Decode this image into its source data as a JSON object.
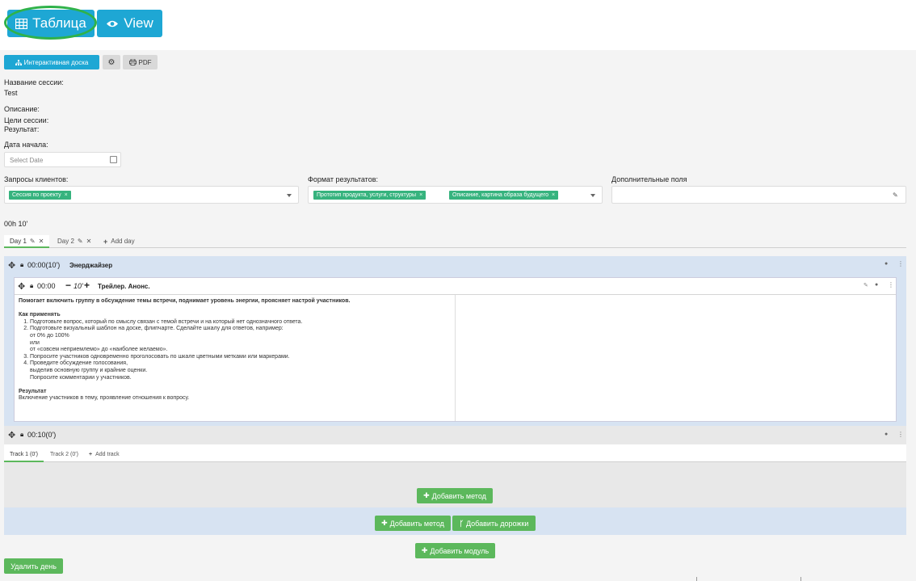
{
  "top_buttons": {
    "table": "Таблица",
    "view": "View"
  },
  "toolbar": {
    "board": "Интерактивная доска",
    "pdf": "PDF"
  },
  "session": {
    "name_label": "Название сессии:",
    "name_value": "Test",
    "description_label": "Описание:",
    "goals_label": "Цели сессии:",
    "result_label": "Результат:",
    "start_label": "Дата начала:",
    "date_placeholder": "Select Date"
  },
  "filters": {
    "client_requests_label": "Запросы клиентов:",
    "client_tag": "Сессия по проекту",
    "result_format_label": "Формат результатов:",
    "format_tags": [
      "Прототип продукта, услуги, структуры",
      "Описание, картина образа будущего"
    ],
    "extra_fields_label": "Дополнительные поля"
  },
  "duration": "00h 10'",
  "day_tabs": {
    "day1": "Day 1",
    "day2": "Day 2",
    "add": "Add day"
  },
  "module1": {
    "time": "00:00(10')",
    "name": "Энерджайзер",
    "method": {
      "time": "00:00",
      "duration": "10'",
      "name": "Трейлер. Анонс.",
      "intro": "Помогает включить группу в обсуждение темы встречи, поднимает уровень энергии, проясняет настрой участников.",
      "how_title": "Как применять",
      "steps": [
        "Подготовьте вопрос, который по смыслу связан с темой встречи и на который нет однозначного ответа.",
        "Подготовьте визуальный шаблон на доске, флипчарте. Сделайте шкалу для ответов, например:",
        "Попросите участников одновременно проголосовать по шкале цветными метками или маркерами.",
        "Проведите обсуждение голосования,"
      ],
      "step2_lines": [
        "от 0% до 100%",
        "или",
        "от «совсем неприемлемо» до «наиболее желаемо»."
      ],
      "step4_lines": [
        "выделив основную группу и крайние оценки.",
        "Попросите комментарии у участников."
      ],
      "result_title": "Результат",
      "result_text": "Включение участников в тему, проявление отношения к вопросу."
    }
  },
  "module2": {
    "time": "00:10(0')",
    "tracks": {
      "track1": "Track 1 (0')",
      "track2": "Track 2 (0')",
      "add": "Add track"
    },
    "add_method": "Добавить метод"
  },
  "footer_buttons": {
    "add_method": "Добавить метод",
    "add_track": "Добавить дорожки",
    "add_module": "Добавить модуль",
    "delete_day": "Удалить день"
  },
  "colors": {
    "primary": "#1ea7d4",
    "success": "#5cb85c",
    "tag": "#36b37e",
    "module_bg": "#d7e3f2"
  }
}
